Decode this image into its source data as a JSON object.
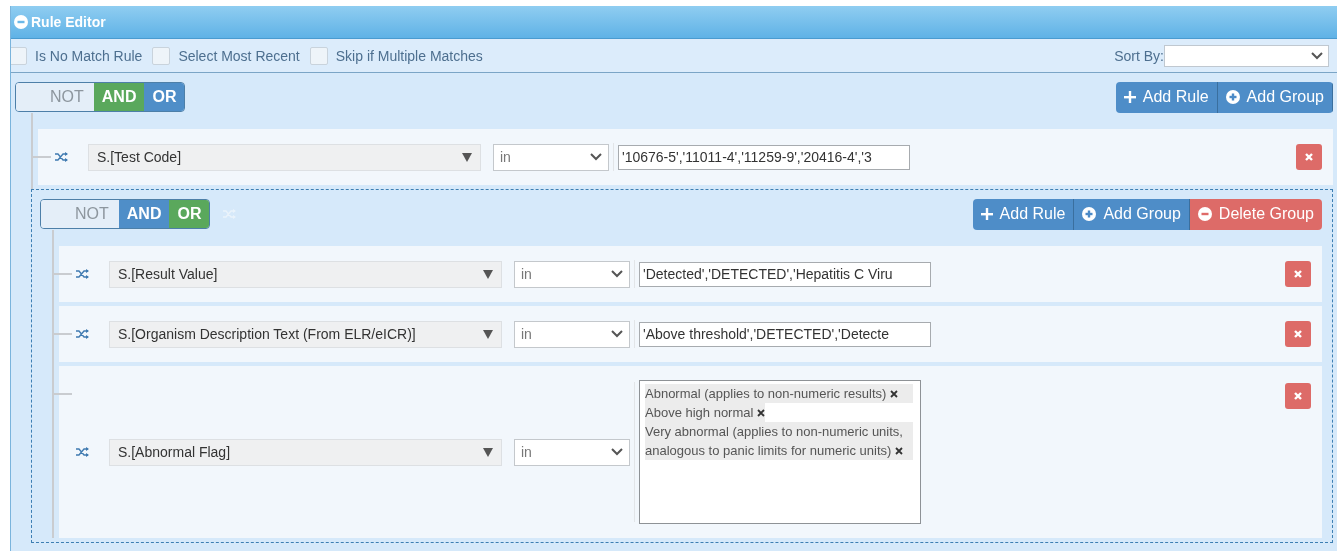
{
  "window": {
    "title": "Rule Editor"
  },
  "options": [
    {
      "label": "Is No Match Rule",
      "checked": false
    },
    {
      "label": "Select Most Recent",
      "checked": false
    },
    {
      "label": "Skip if Multiple Matches",
      "checked": false
    }
  ],
  "sort_by": {
    "label": "Sort By:"
  },
  "root": {
    "conditions": [
      {
        "label": "NOT",
        "selected": false
      },
      {
        "label": "AND",
        "selected": true
      },
      {
        "label": "OR",
        "selected": false
      }
    ],
    "buttons": [
      {
        "label": "Add Rule",
        "kind": "add-rule"
      },
      {
        "label": "Add Group",
        "kind": "add-group"
      }
    ],
    "children": [
      {
        "kind": "rule",
        "field": "S.[Test Code]",
        "operator": "in",
        "value": "'10676-5','11011-4','11259-9','20416-4','3"
      },
      {
        "kind": "group",
        "conditions": [
          {
            "label": "NOT",
            "selected": false
          },
          {
            "label": "AND",
            "selected": false
          },
          {
            "label": "OR",
            "selected": true
          }
        ],
        "buttons": [
          {
            "label": "Add Rule",
            "kind": "add-rule"
          },
          {
            "label": "Add Group",
            "kind": "add-group"
          },
          {
            "label": "Delete Group",
            "kind": "delete-group"
          }
        ],
        "children": [
          {
            "kind": "rule",
            "field": "S.[Result Value]",
            "operator": "in",
            "value": "'Detected','DETECTED','Hepatitis C Viru"
          },
          {
            "kind": "rule",
            "field": "S.[Organism Description Text (From ELR/eICR)]",
            "operator": "in",
            "value": "'Above threshold','DETECTED','Detecte"
          },
          {
            "kind": "rule",
            "field": "S.[Abnormal Flag]",
            "operator": "in",
            "tags": [
              "Abnormal (applies to non-numeric results)",
              "Above high normal",
              "Very abnormal (applies to non-numeric units, analogous to panic limits for numeric units)"
            ]
          }
        ]
      }
    ]
  }
}
